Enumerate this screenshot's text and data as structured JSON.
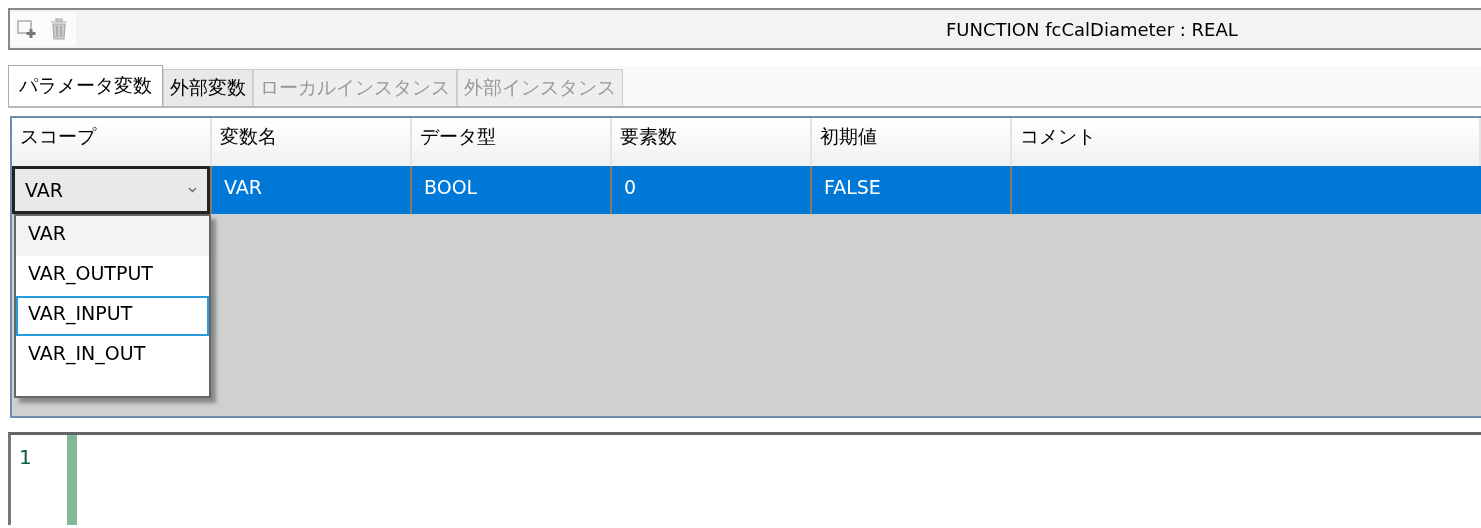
{
  "toolbar": {
    "title": "FUNCTION fcCalDiameter : REAL"
  },
  "tabs": [
    {
      "label": "パラメータ変数",
      "selected": true,
      "disabled": false
    },
    {
      "label": "外部変数",
      "selected": false,
      "disabled": false
    },
    {
      "label": "ローカルインスタンス",
      "selected": false,
      "disabled": true
    },
    {
      "label": "外部インスタンス",
      "selected": false,
      "disabled": true
    }
  ],
  "table": {
    "columns": [
      "スコープ",
      "変数名",
      "データ型",
      "要素数",
      "初期値",
      "コメント"
    ],
    "rows": [
      {
        "selected": true,
        "cells": [
          "VAR",
          "VAR",
          "BOOL",
          "0",
          "FALSE"
        ]
      }
    ]
  },
  "dropdown": {
    "expanded": true,
    "options": [
      {
        "label": "VAR",
        "selected": true,
        "focused": false
      },
      {
        "label": "VAR_OUTPUT",
        "selected": false,
        "focused": false
      },
      {
        "label": "VAR_INPUT",
        "selected": false,
        "focused": true
      },
      {
        "label": "VAR_IN_OUT",
        "selected": false,
        "focused": false
      }
    ]
  },
  "editor": {
    "line_numbers": [
      "1"
    ]
  }
}
